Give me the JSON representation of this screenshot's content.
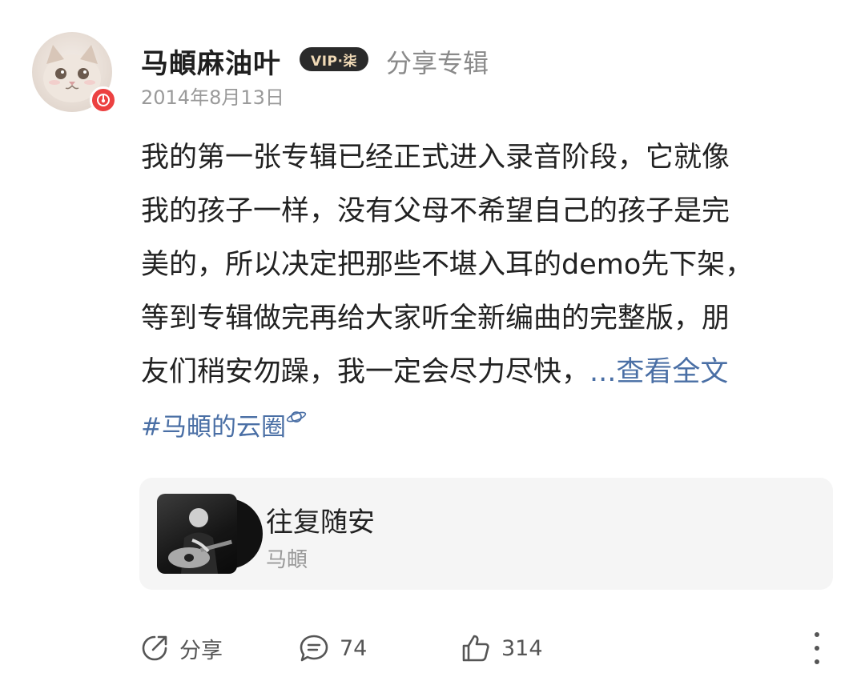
{
  "post": {
    "user_name": "马頔麻油叶",
    "vip_label": "VIP·柒",
    "action": "分享专辑",
    "date": "2014年8月13日",
    "body_lines": [
      "我的第一张专辑已经正式进入录音阶段，它就像",
      "我的孩子一样，没有父母不希望自己的孩子是完",
      "美的，所以决定把那些不堪入耳的demo先下架，",
      "等到专辑做完再给大家听全新编曲的完整版，朋",
      "友们稍安勿躁，我一定会尽力尽快，"
    ],
    "expand_label": "...查看全文",
    "hashtag": "#马頔的云圈"
  },
  "music_card": {
    "title": "往复随安",
    "artist": "马頔"
  },
  "toolbar": {
    "share_label": "分享",
    "comment_count": "74",
    "like_count": "314"
  },
  "icons": {
    "avatar_badge": "music-note-icon",
    "hashtag_suffix": "planet-icon",
    "share": "share-icon",
    "comment": "comment-icon",
    "like": "thumbs-up-icon",
    "more": "more-vertical-icon"
  },
  "colors": {
    "link": "#4a6fa5",
    "badge_red": "#ec4141",
    "vip_gold": "#f0d9b5"
  }
}
